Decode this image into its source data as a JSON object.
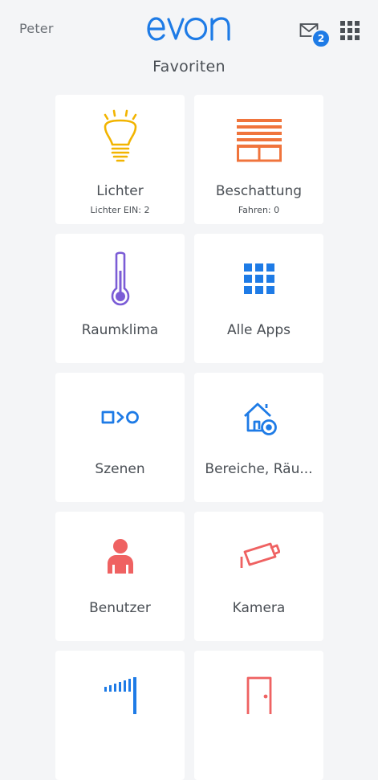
{
  "header": {
    "user_name": "Peter",
    "logo_text": "evon",
    "unread_messages": "2",
    "page_title": "Favoriten"
  },
  "tiles": [
    {
      "label": "Lichter",
      "sub": "Lichter EIN: 2",
      "icon": "light-bulb-icon",
      "color": "#f2b400"
    },
    {
      "label": "Beschattung",
      "sub": "Fahren: 0",
      "icon": "blinds-icon",
      "color": "#f0743c"
    },
    {
      "label": "Raumklima",
      "sub": "",
      "icon": "thermometer-icon",
      "color": "#7b5cd6"
    },
    {
      "label": "Alle Apps",
      "sub": "",
      "icon": "grid-icon",
      "color": "#1e7be6"
    },
    {
      "label": "Szenen",
      "sub": "",
      "icon": "scene-icon",
      "color": "#1e7be6"
    },
    {
      "label": "Bereiche, Räu...",
      "sub": "",
      "icon": "house-icon",
      "color": "#1e7be6"
    },
    {
      "label": "Benutzer",
      "sub": "",
      "icon": "person-icon",
      "color": "#ef6262"
    },
    {
      "label": "Kamera",
      "sub": "",
      "icon": "camera-icon",
      "color": "#ef6262"
    },
    {
      "label": "",
      "sub": "",
      "icon": "signal-icon",
      "color": "#1e7be6"
    },
    {
      "label": "",
      "sub": "",
      "icon": "door-icon",
      "color": "#ef6262"
    }
  ]
}
